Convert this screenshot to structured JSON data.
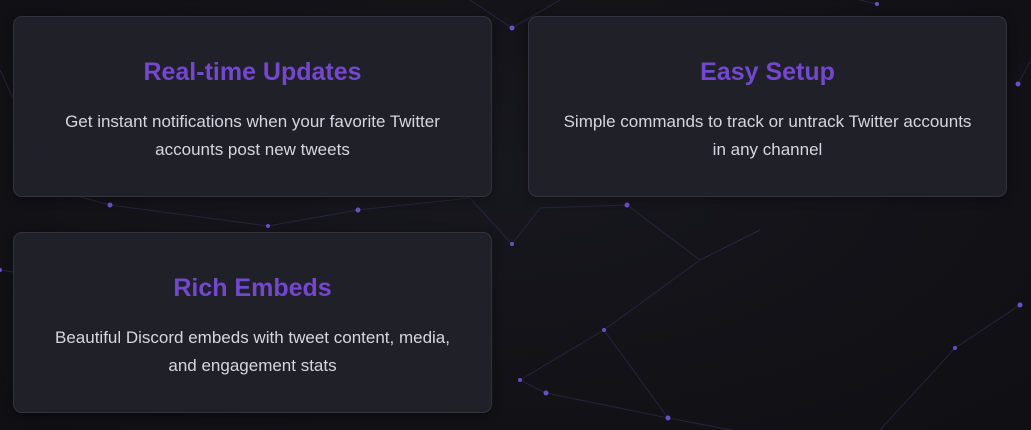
{
  "theme": {
    "accent_color": "#7447cf",
    "text_color": "#d6d6de"
  },
  "features": [
    {
      "title": "Real-time Updates",
      "description": "Get instant notifications when your favorite Twitter accounts post new tweets"
    },
    {
      "title": "Easy Setup",
      "description": "Simple commands to track or untrack Twitter accounts in any channel"
    },
    {
      "title": "Rich Embeds",
      "description": "Beautiful Discord embeds with tweet content, media, and engagement stats"
    }
  ]
}
